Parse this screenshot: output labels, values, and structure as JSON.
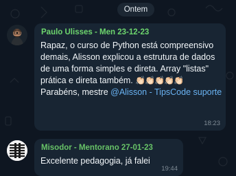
{
  "date_separator": "Ontem",
  "messages": [
    {
      "sender": "Paulo Ulisses - Men 23-12-23",
      "text_main": "Rapaz, o curso de Python está compreensivo demais, Alisson explicou a estrutura de dados de uma forma simples e direta.  Array \"listas\" prática e direta também. ",
      "emoji": "👏🏻👏🏻👏🏻👏🏻👏🏻",
      "text_after": " Parabéns, mestre ",
      "mention": "@Alisson - TipsCode suporte",
      "time": "18:23",
      "sender_color": "#6dd56d"
    },
    {
      "sender": "Misodor - Mentorano 27-01-23",
      "text_main": "Excelente pedagogia, já falei",
      "time": "19:44",
      "sender_color": "#67c267"
    }
  ],
  "colors": {
    "background": "#0e1621",
    "bubble": "#182533",
    "mention": "#6ab3f3"
  }
}
